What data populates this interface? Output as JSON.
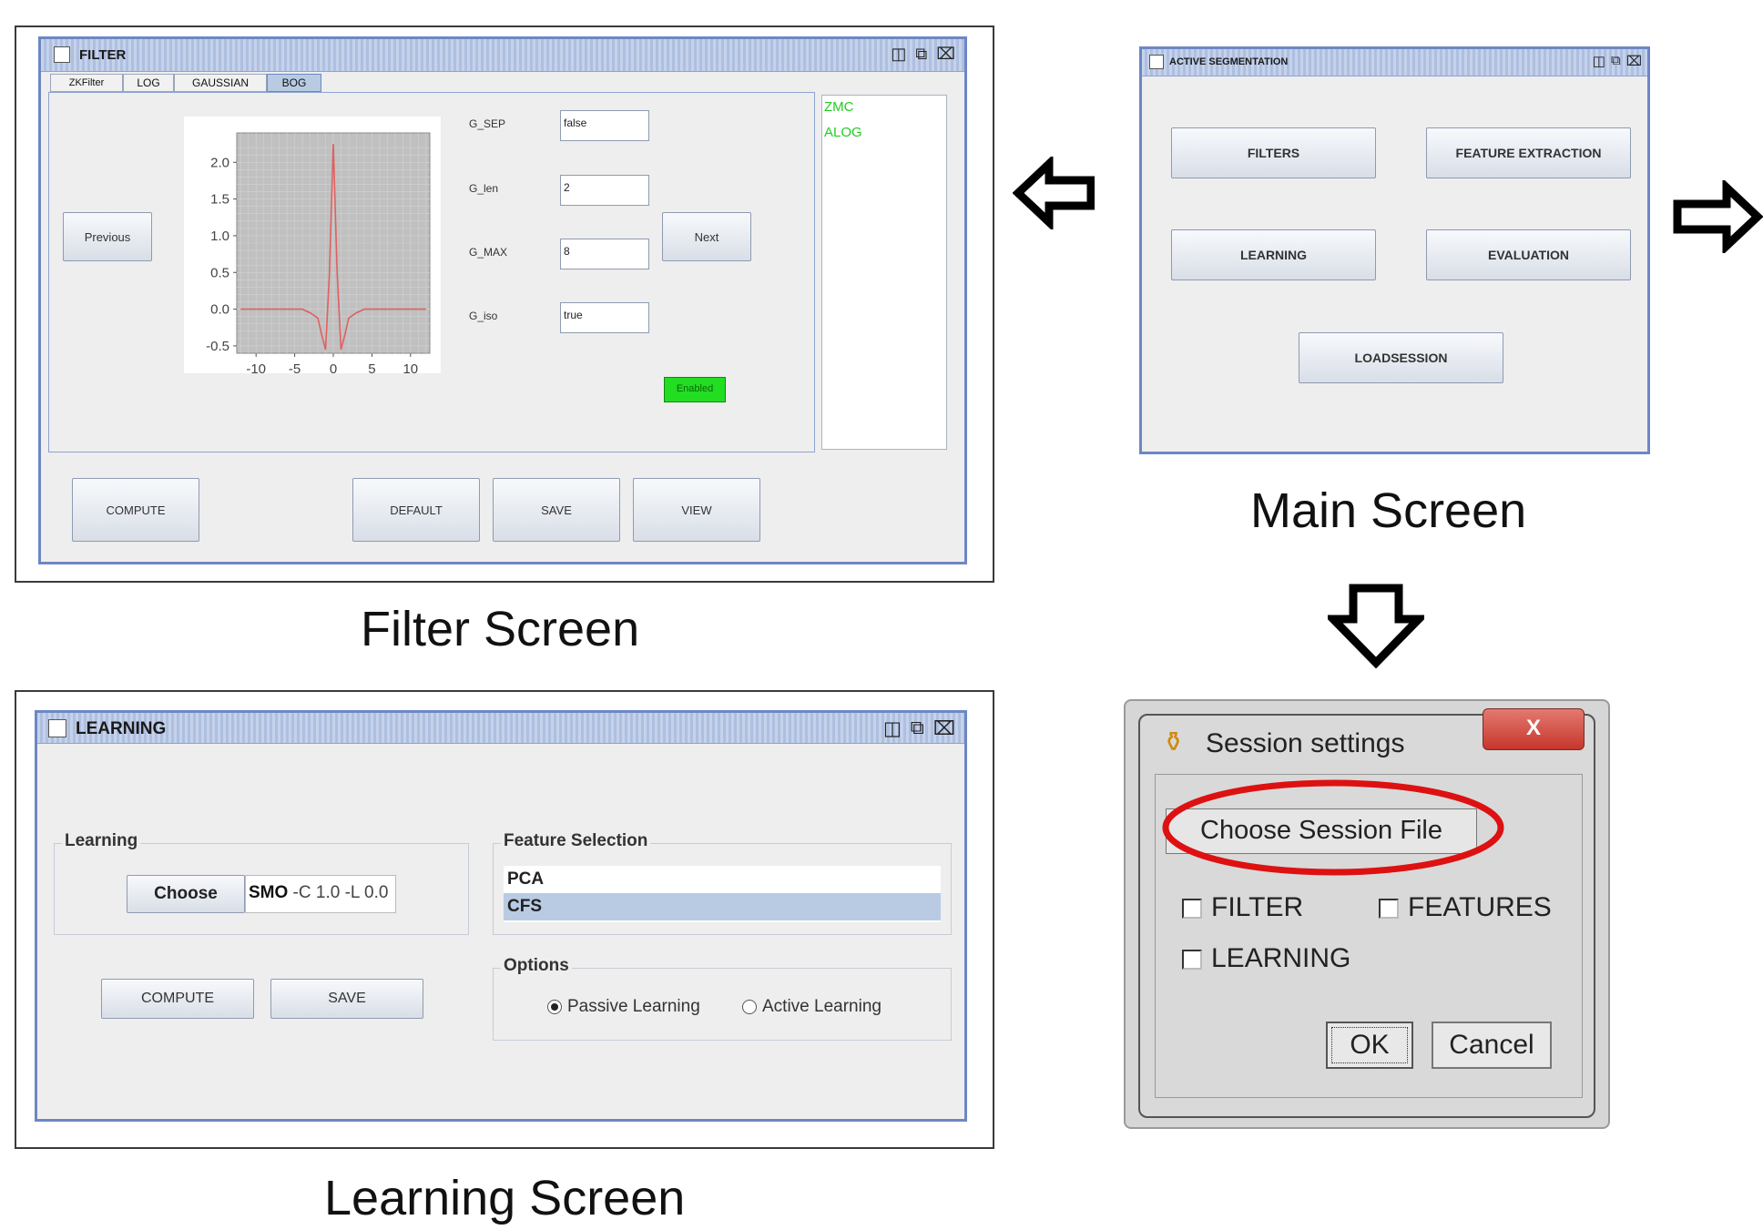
{
  "filter": {
    "title": "FILTER",
    "tabs": [
      "ZKFilter",
      "LOG",
      "GAUSSIAN",
      "BOG"
    ],
    "previous": "Previous",
    "next": "Next",
    "params": [
      {
        "label": "G_SEP",
        "value": "false"
      },
      {
        "label": "G_len",
        "value": "2"
      },
      {
        "label": "G_MAX",
        "value": "8"
      },
      {
        "label": "G_iso",
        "value": "true"
      }
    ],
    "enabled": "Enabled",
    "list": [
      "ZMC",
      "ALOG"
    ],
    "buttons": {
      "compute": "COMPUTE",
      "default": "DEFAULT",
      "save": "SAVE",
      "view": "VIEW"
    },
    "caption": "Filter Screen"
  },
  "chart_data": {
    "type": "line",
    "x": [
      -12,
      -10,
      -8,
      -6,
      -4,
      -3,
      -2,
      -1.5,
      -1,
      -0.5,
      0,
      0.5,
      1,
      1.5,
      2,
      3,
      4,
      6,
      8,
      10,
      12
    ],
    "y": [
      0.0,
      0.0,
      0.0,
      0.0,
      0.0,
      -0.05,
      -0.12,
      -0.35,
      -0.55,
      0.5,
      2.25,
      0.5,
      -0.55,
      -0.35,
      -0.12,
      -0.05,
      0.0,
      0.0,
      0.0,
      0.0,
      0.0
    ],
    "xticks": [
      "-10",
      "-5",
      "0",
      "5",
      "10"
    ],
    "yticks": [
      "2.0",
      "1.5",
      "1.0",
      "0.5",
      "0.0",
      "-0.5"
    ],
    "xlim": [
      -12.5,
      12.5
    ],
    "ylim": [
      -0.6,
      2.4
    ],
    "grid": true,
    "line_color": "#e06060",
    "plot_bg": "#c0c0c0"
  },
  "main": {
    "title": "ACTIVE SEGMENTATION",
    "buttons": {
      "filters": "FILTERS",
      "features": "FEATURE EXTRACTION",
      "learning": "LEARNING",
      "evaluation": "EVALUATION",
      "load": "LOADSESSION"
    },
    "caption": "Main Screen"
  },
  "learning": {
    "title": "LEARNING",
    "learning_group": "Learning",
    "choose": "Choose",
    "classifier_name": "SMO",
    "classifier_args": " -C 1.0 -L 0.0",
    "feature_group": "Feature Selection",
    "features": [
      "PCA",
      "CFS"
    ],
    "options_group": "Options",
    "passive": "Passive Learning",
    "active": "Active Learning",
    "compute": "COMPUTE",
    "save": "SAVE",
    "caption": "Learning Screen"
  },
  "session": {
    "title": "Session settings",
    "close": "X",
    "choose_file": "Choose Session File",
    "filter": "FILTER",
    "features": "FEATURES",
    "learning": "LEARNING",
    "ok": "OK",
    "cancel": "Cancel"
  },
  "colors": {
    "window_border": "#6d87c4",
    "enabled_green": "#22dd22",
    "list_green": "#22cc22",
    "highlight_red": "#dd1111",
    "selection_blue": "#b8cbe3",
    "close_red": "#c9443c"
  }
}
